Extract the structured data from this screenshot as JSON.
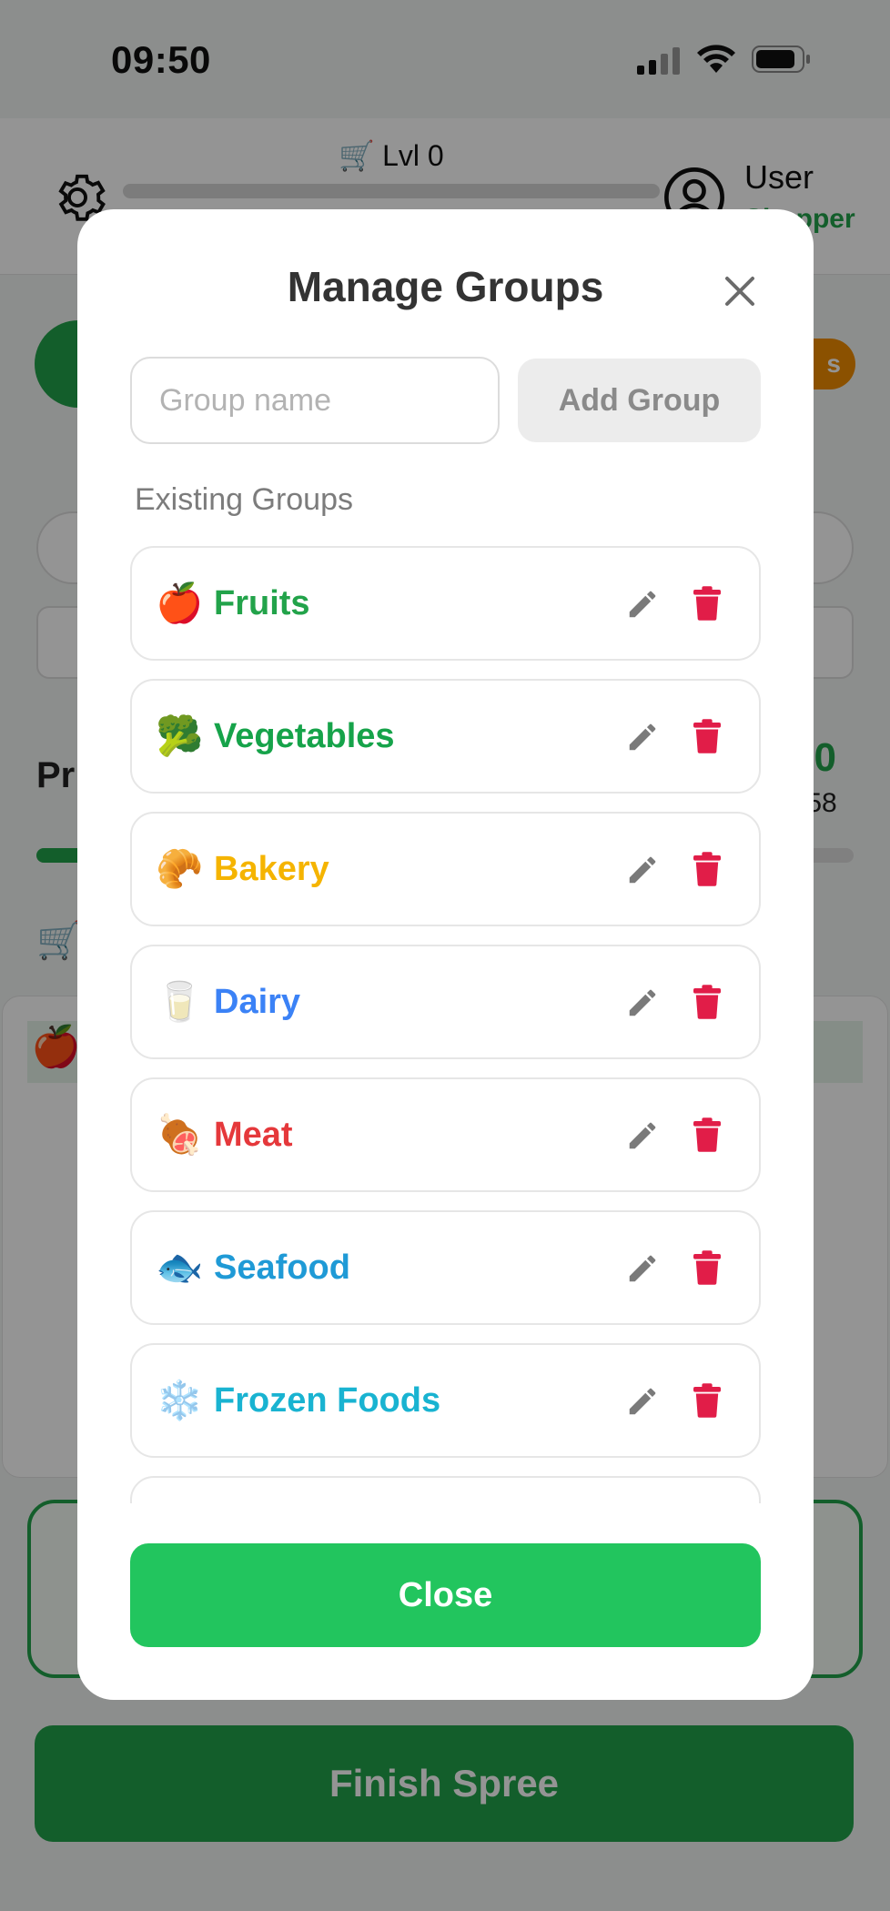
{
  "status_bar": {
    "time": "09:50"
  },
  "header": {
    "level_label": "Lvl 0",
    "level_progress": 0,
    "user_name": "User",
    "user_role": "Shopper"
  },
  "background": {
    "badge_text": "s",
    "section_title_partial": "Pr",
    "total_value_partial": "30",
    "total_sub_partial": ".58",
    "shopping_progress": 0.06,
    "finish_button": "Finish Spree"
  },
  "modal": {
    "title": "Manage Groups",
    "input_placeholder": "Group name",
    "input_value": "",
    "add_button": "Add Group",
    "section_label": "Existing Groups",
    "close_button": "Close",
    "groups": [
      {
        "emoji": "🍎",
        "name": "Fruits",
        "color": "#22a34a"
      },
      {
        "emoji": "🥦",
        "name": "Vegetables",
        "color": "#16a34a"
      },
      {
        "emoji": "🥐",
        "name": "Bakery",
        "color": "#f5b400"
      },
      {
        "emoji": "🥛",
        "name": "Dairy",
        "color": "#3b82f6"
      },
      {
        "emoji": "🍖",
        "name": "Meat",
        "color": "#e5383b"
      },
      {
        "emoji": "🐟",
        "name": "Seafood",
        "color": "#1f9ad6"
      },
      {
        "emoji": "❄️",
        "name": "Frozen Foods",
        "color": "#19b3d1"
      },
      {
        "emoji": "",
        "name": "",
        "color": "#888888"
      }
    ]
  },
  "colors": {
    "primary_green": "#22c55e",
    "dark_green": "#22a34a",
    "delete_red": "#e11d48",
    "edit_gray": "#7a7a7a"
  },
  "icons": {
    "settings": "gear-icon",
    "user": "user-circle-icon",
    "cart": "cart-icon",
    "close": "close-icon",
    "edit": "pencil-icon",
    "delete": "trash-icon"
  }
}
